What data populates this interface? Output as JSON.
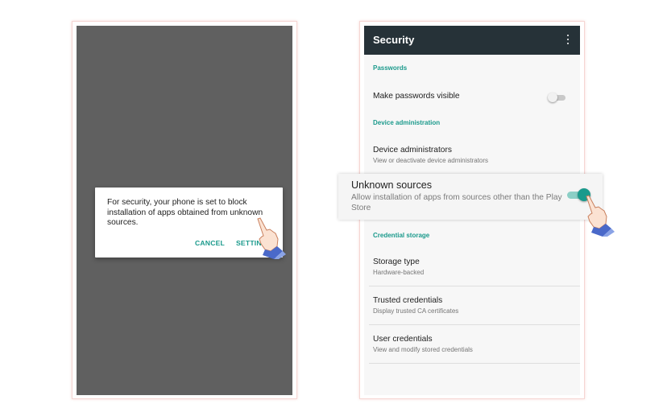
{
  "left_screen": {
    "dialog": {
      "message": "For security, your phone is set to block installation of apps obtained from unknown sources.",
      "cancel_label": "CANCEL",
      "settings_label": "SETTINGS"
    }
  },
  "right_screen": {
    "app_bar": {
      "title": "Security",
      "menu_icon": "more-vertical-icon"
    },
    "sections": {
      "passwords": {
        "header": "Passwords",
        "make_visible": {
          "title": "Make passwords visible",
          "enabled": false
        }
      },
      "device_admin": {
        "header": "Device administration",
        "device_admins": {
          "title": "Device administrators",
          "summary": "View or deactivate device administrators"
        }
      },
      "credential_storage": {
        "header": "Credential storage",
        "storage_type": {
          "title": "Storage type",
          "summary": "Hardware-backed"
        },
        "trusted_credentials": {
          "title": "Trusted credentials",
          "summary": "Display trusted CA certificates"
        },
        "user_credentials": {
          "title": "User credentials",
          "summary": "View and modify stored credentials"
        }
      }
    },
    "unknown_sources": {
      "title": "Unknown sources",
      "summary": "Allow installation of apps from sources other than the Play Store",
      "enabled": true
    }
  },
  "colors": {
    "accent": "#1b9a8c",
    "app_bar": "#263238",
    "dim_overlay": "#606060",
    "frame_border": "#f6d6d3"
  },
  "icons": [
    "pointing-hand-icon",
    "more-vertical-icon",
    "toggle-switch-icon"
  ]
}
